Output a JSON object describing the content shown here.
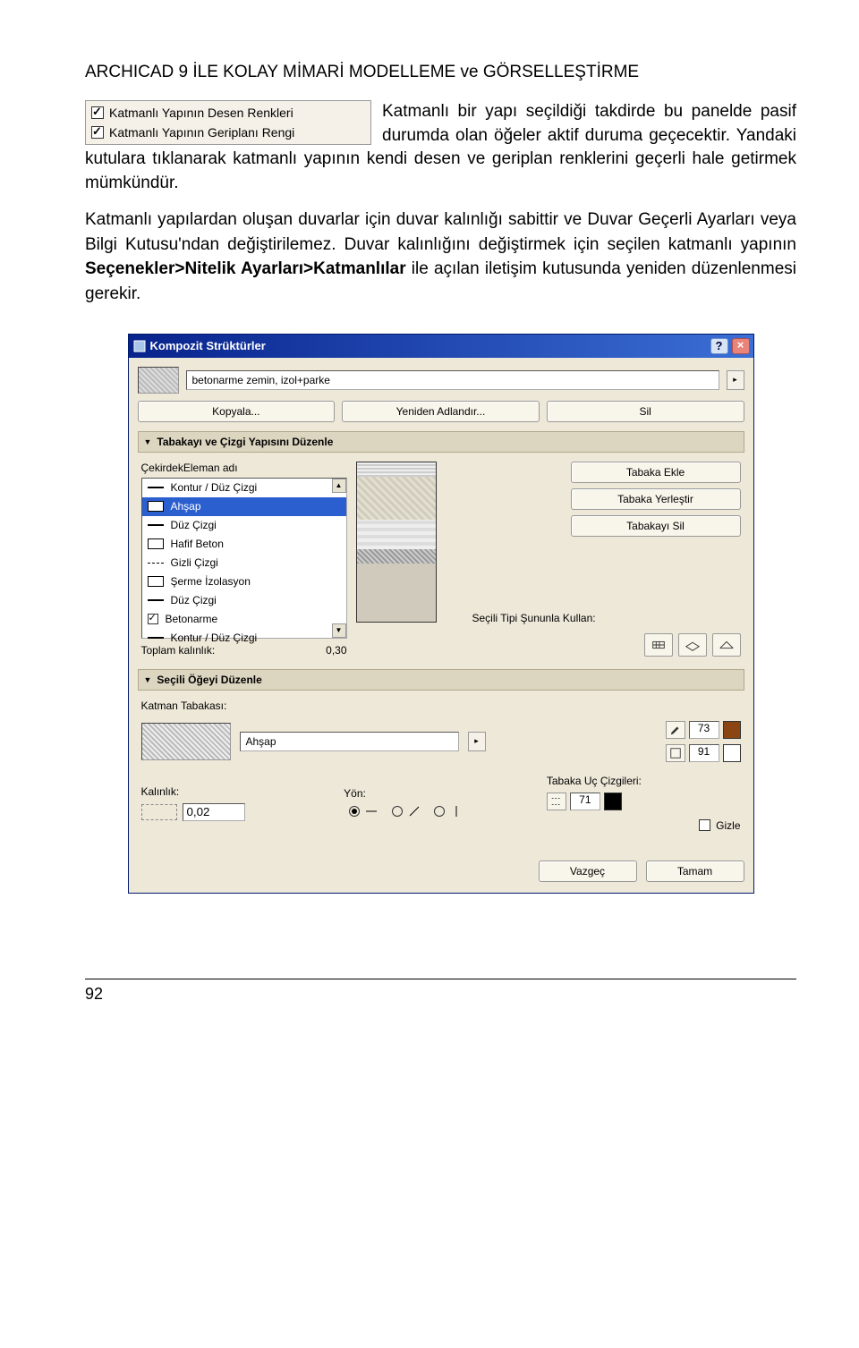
{
  "doc": {
    "title": "ARCHICAD 9 İLE KOLAY MİMARİ MODELLEME ve GÖRSELLEŞTİRME",
    "page_number": "92"
  },
  "cbx": {
    "opt1": "Katmanlı Yapının Desen Renkleri",
    "opt2": "Katmanlı Yapının Geriplanı Rengi"
  },
  "text": {
    "intro": "Katmanlı bir yapı seçildiği takdirde bu panelde pasif durumda olan öğeler aktif duruma geçecektir. Yandaki kutulara tıklanarak katmanlı yapının kendi desen ve geriplan renklerini geçerli hale getirmek mümkündür.",
    "para2a": "Katmanlı yapılardan oluşan duvarlar için duvar kalınlığı sabittir ve Duvar Geçerli Ayarları veya Bilgi Kutusu'ndan değiştirilemez. Duvar kalınlığını değiştirmek için seçilen katmanlı yapının ",
    "para2b": "Seçenekler>Nitelik Ayarları>Katmanlılar",
    "para2c": " ile açılan iletişim kutusunda yeniden düzenlenmesi gerekir."
  },
  "dialog": {
    "title": "Kompozit Strüktürler",
    "help": "?",
    "close": "×",
    "struct_name": "betonarme zemin, izol+parke",
    "btn_copy": "Kopyala...",
    "btn_rename": "Yeniden Adlandır...",
    "btn_delete": "Sil",
    "sec_layers": "Tabakayı ve Çizgi Yapısını Düzenle",
    "elem_name": "ÇekirdekEleman adı",
    "layers": [
      "Kontur /  Düz Çizgi",
      "Ahşap",
      "Düz Çizgi",
      "Hafif Beton",
      "Gizli Çizgi",
      "Şerme İzolasyon",
      "Düz Çizgi",
      "Betonarme",
      "Kontur /  Düz Çizgi"
    ],
    "total_label": "Toplam kalınlık:",
    "total_value": "0,30",
    "btn_add": "Tabaka Ekle",
    "btn_insert": "Tabaka Yerleştir",
    "btn_remove": "Tabakayı Sil",
    "use_label": "Seçili Tipi Şununla Kullan:",
    "sec_edit": "Seçili Öğeyi Düzenle",
    "layer_label": "Katman Tabakası:",
    "material": "Ahşap",
    "pop": "▸",
    "pen1": "73",
    "pen2": "91",
    "thickness_label": "Kalınlık:",
    "thickness_value": "0,02",
    "direction_label": "Yön:",
    "endlines_label": "Tabaka Uç Çizgileri:",
    "pen3": "71",
    "hide_label": "Gizle",
    "btn_cancel": "Vazgeç",
    "btn_ok": "Tamam"
  }
}
